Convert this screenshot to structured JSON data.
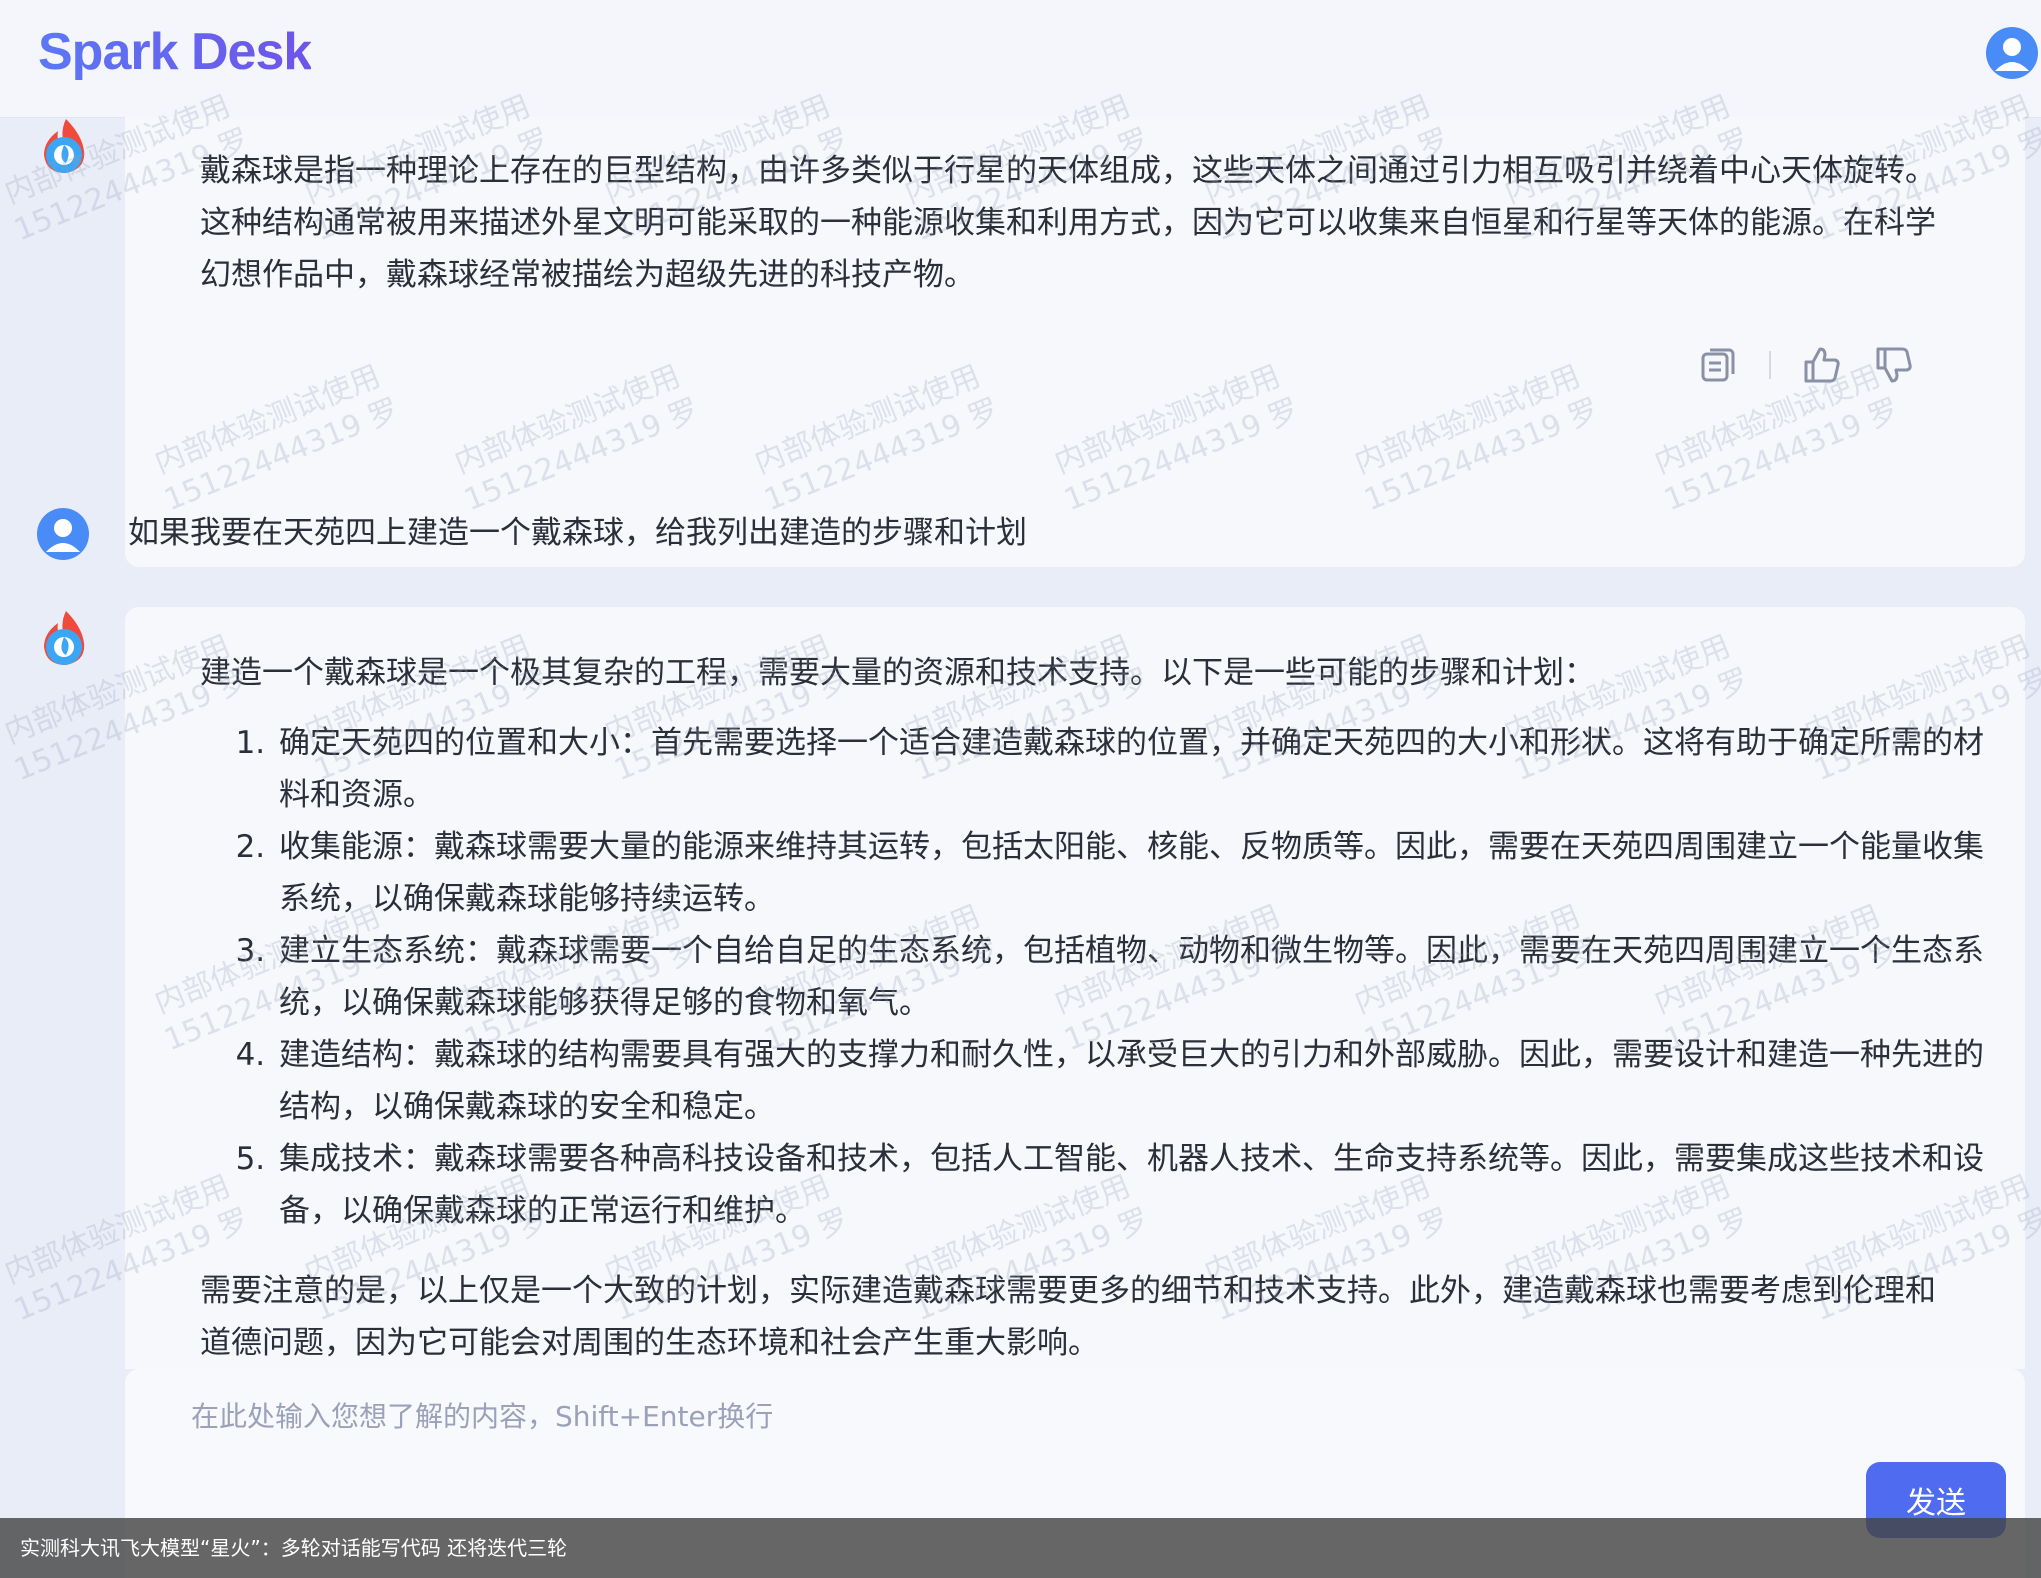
{
  "app": {
    "logo": "Spark Desk"
  },
  "icons": {
    "user_avatar": "user-avatar-icon",
    "bot_avatar": "spark-flame-icon",
    "copy": "copy-icon",
    "like": "thumbs-up-icon",
    "dislike": "thumbs-down-icon"
  },
  "colors": {
    "accent": "#4f6cf0",
    "background": "#e9edf8",
    "bubble": "#f7f8fc"
  },
  "messages": {
    "bot1": {
      "text": "戴森球是指一种理论上存在的巨型结构，由许多类似于行星的天体组成，这些天体之间通过引力相互吸引并绕着中心天体旋转。这种结构通常被用来描述外星文明可能采取的一种能源收集和利用方式，因为它可以收集来自恒星和行星等天体的能源。在科学幻想作品中，戴森球经常被描绘为超级先进的科技产物。"
    },
    "user1": {
      "text": "如果我要在天苑四上建造一个戴森球，给我列出建造的步骤和计划"
    },
    "bot2": {
      "intro": "建造一个戴森球是一个极其复杂的工程，需要大量的资源和技术支持。以下是一些可能的步骤和计划：",
      "steps": [
        "确定天苑四的位置和大小：首先需要选择一个适合建造戴森球的位置，并确定天苑四的大小和形状。这将有助于确定所需的材料和资源。",
        "收集能源：戴森球需要大量的能源来维持其运转，包括太阳能、核能、反物质等。因此，需要在天苑四周围建立一个能量收集系统，以确保戴森球能够持续运转。",
        "建立生态系统：戴森球需要一个自给自足的生态系统，包括植物、动物和微生物等。因此，需要在天苑四周围建立一个生态系统，以确保戴森球能够获得足够的食物和氧气。",
        "建造结构：戴森球的结构需要具有强大的支撑力和耐久性，以承受巨大的引力和外部威胁。因此，需要设计和建造一种先进的结构，以确保戴森球的安全和稳定。",
        "集成技术：戴森球需要各种高科技设备和技术，包括人工智能、机器人技术、生命支持系统等。因此，需要集成这些技术和设备，以确保戴森球的正常运行和维护。"
      ],
      "outro": "需要注意的是，以上仅是一个大致的计划，实际建造戴森球需要更多的细节和技术支持。此外，建造戴森球也需要考虑到伦理和道德问题，因为它可能会对周围的生态环境和社会产生重大影响。"
    }
  },
  "input": {
    "placeholder": "在此处输入您想了解的内容，Shift+Enter换行",
    "value": ""
  },
  "send_label": "发送",
  "watermark": {
    "line1": "内部体验测试使用",
    "line2": "15122444319 罗"
  },
  "caption": "实测科大讯飞大模型“星火”：多轮对话能写代码  还将迭代三轮"
}
